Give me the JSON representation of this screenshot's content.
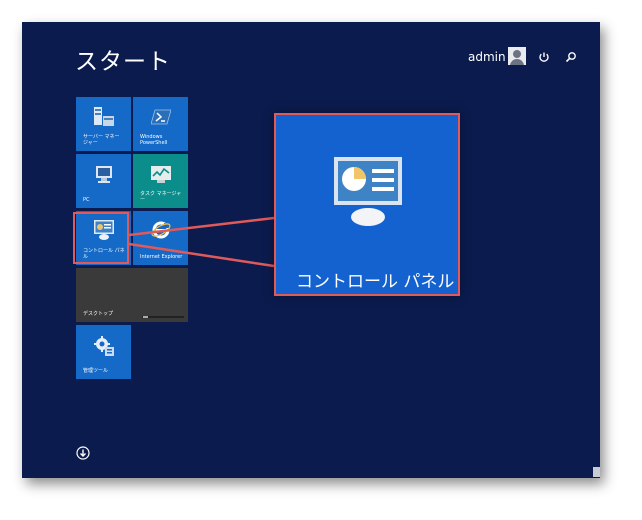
{
  "start": {
    "title": "スタート"
  },
  "user": {
    "name": "admin"
  },
  "icons": {
    "avatar": "user-avatar-icon",
    "power": "power-icon",
    "search": "search-icon",
    "all_apps": "down-arrow-circle-icon"
  },
  "tiles": [
    {
      "label": "サーバー マネー\nジャー",
      "icon": "server-manager-icon"
    },
    {
      "label": "Windows\nPowerShell",
      "icon": "powershell-icon"
    },
    {
      "label": "PC",
      "icon": "pc-icon"
    },
    {
      "label": "タスク マネージャー",
      "icon": "task-manager-icon"
    },
    {
      "label": "コントロール パネル",
      "icon": "control-panel-icon"
    },
    {
      "label": "Internet Explorer",
      "icon": "internet-explorer-icon"
    },
    {
      "label": "デスクトップ",
      "icon": "desktop-icon"
    },
    {
      "label": "管理ツール",
      "icon": "admin-tools-icon"
    }
  ],
  "zoom": {
    "label": "コントロール パネル"
  },
  "colors": {
    "background": "#0b1b4d",
    "tile_blue": "#1569c7",
    "tile_teal": "#0b8d8c",
    "tile_desktop": "#3a3a3a",
    "highlight": "#e05a5a"
  }
}
